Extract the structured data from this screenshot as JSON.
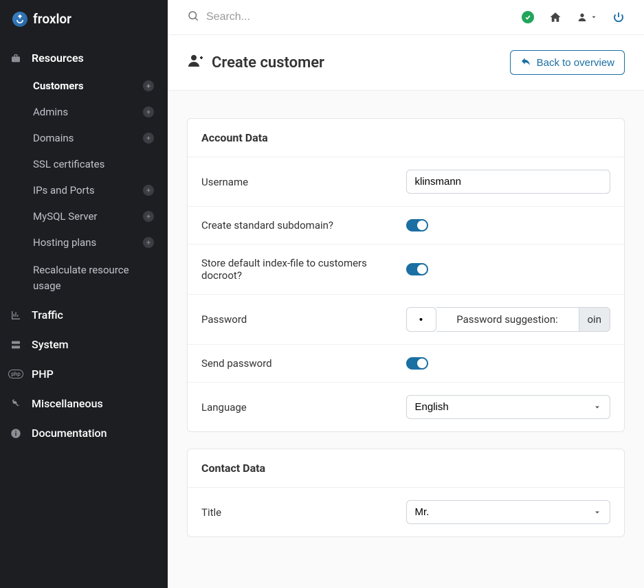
{
  "brand": "froxlor",
  "search": {
    "placeholder": "Search..."
  },
  "sidebar": {
    "resources_label": "Resources",
    "items": [
      {
        "label": "Customers",
        "has_plus": true,
        "active": true
      },
      {
        "label": "Admins",
        "has_plus": true
      },
      {
        "label": "Domains",
        "has_plus": true
      },
      {
        "label": "SSL certificates",
        "has_plus": false
      },
      {
        "label": "IPs and Ports",
        "has_plus": true
      },
      {
        "label": "MySQL Server",
        "has_plus": true
      },
      {
        "label": "Hosting plans",
        "has_plus": true
      },
      {
        "label": "Recalculate resource usage",
        "has_plus": false,
        "wrap": true
      }
    ],
    "top_items": [
      {
        "label": "Traffic",
        "icon": "chart-icon"
      },
      {
        "label": "System",
        "icon": "server-icon"
      },
      {
        "label": "PHP",
        "icon": "php-icon"
      },
      {
        "label": "Miscellaneous",
        "icon": "wrench-icon"
      },
      {
        "label": "Documentation",
        "icon": "info-icon"
      }
    ]
  },
  "page": {
    "title": "Create customer",
    "back_label": "Back to overview"
  },
  "sections": {
    "account": {
      "heading": "Account Data",
      "fields": {
        "username": {
          "label": "Username",
          "value": "klinsmann"
        },
        "subdomain": {
          "label": "Create standard subdomain?",
          "value": true
        },
        "indexfile": {
          "label": "Store default index-file to customers docroot?",
          "value": true
        },
        "password": {
          "label": "Password",
          "value": "•",
          "suggestion_label": "Password suggestion:",
          "suggestion_value": "oin"
        },
        "send_password": {
          "label": "Send password",
          "value": true
        },
        "language": {
          "label": "Language",
          "value": "English",
          "options": [
            "English"
          ]
        }
      }
    },
    "contact": {
      "heading": "Contact Data",
      "fields": {
        "title": {
          "label": "Title",
          "value": "Mr.",
          "options": [
            "Mr."
          ]
        }
      }
    }
  },
  "colors": {
    "accent": "#1a6fa3",
    "success": "#22a55a"
  }
}
